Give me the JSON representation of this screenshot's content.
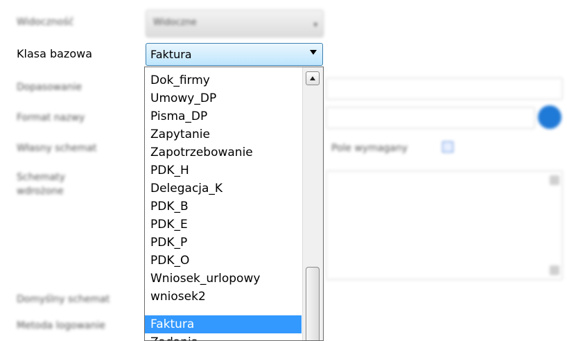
{
  "form": {
    "row1_label": "Widoczność",
    "row1_value": "Widoczne",
    "klasa_label": "Klasa bazowa",
    "klasa_value": "Faktura",
    "blur_label_3": "Dopasowanie",
    "blur_label_4": "Format nazwy",
    "blur_label_5": "Własny schemat",
    "blur_label_6a": "Schematy",
    "blur_label_6b": "wdrożone",
    "blur_label_7": "Domyślny schemat",
    "blur_label_8": "Metoda logowanie",
    "wymagany_label": "Pole wymagany"
  },
  "dropdown": {
    "items": [
      "Dok_firmy",
      "Umowy_DP",
      "Pisma_DP",
      "Zapytanie",
      "Zapotrzebowanie",
      "PDK_H",
      "Delegacja_K",
      "PDK_B",
      "PDK_E",
      "PDK_P",
      "PDK_O",
      "Wniosek_urlopowy",
      "wniosek2",
      "Faktura",
      "Zadania"
    ],
    "selected": "Faktura"
  },
  "colors": {
    "selection": "#3399ff",
    "info_icon": "#1f79d6"
  }
}
